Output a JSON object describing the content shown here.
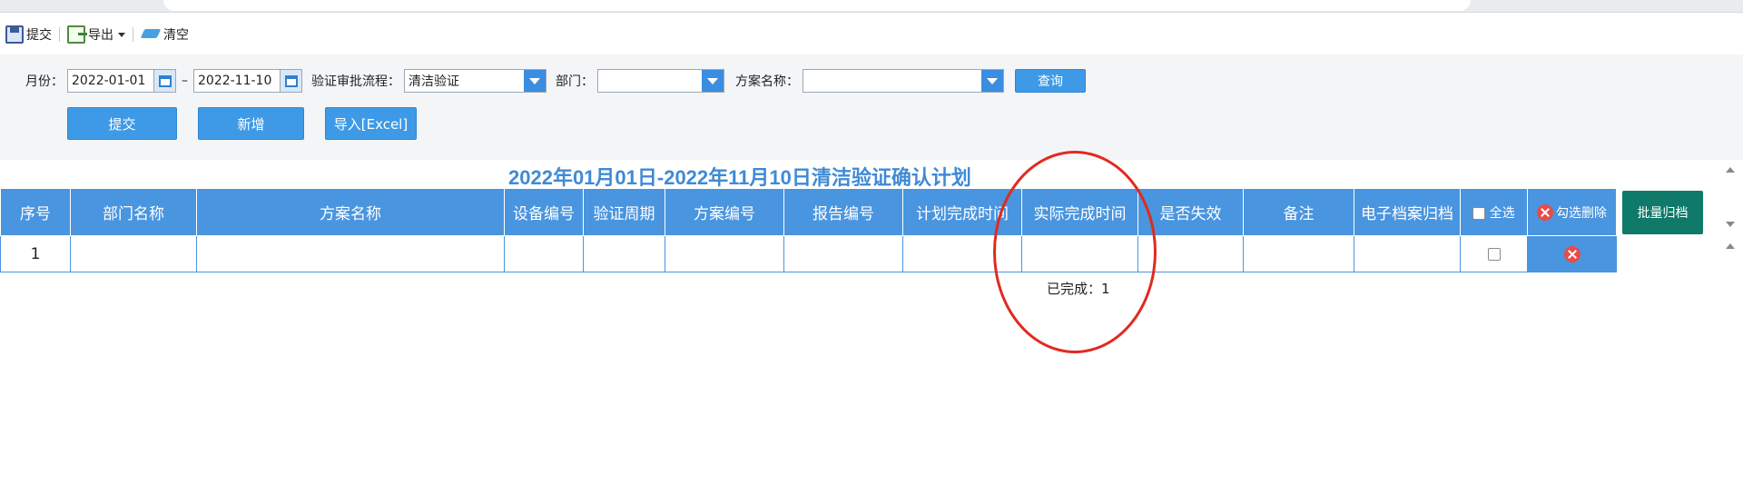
{
  "toolbar": {
    "submit_label": "提交",
    "export_label": "导出",
    "clear_label": "清空"
  },
  "filters": {
    "month_label": "月份：",
    "date_from": "2022-01-01",
    "date_sep": "–",
    "date_to": "2022-11-10",
    "process_label": "验证审批流程：",
    "process_value": "清洁验证",
    "dept_label": "部门：",
    "dept_value": "",
    "plan_label": "方案名称：",
    "plan_value": "",
    "query_label": "查询"
  },
  "actions": {
    "submit_label": "提交",
    "add_label": "新增",
    "import_label": "导入[Excel]"
  },
  "report": {
    "title": "2022年01月01日-2022年11月10日清洁验证确认计划"
  },
  "table": {
    "columns": [
      "序号",
      "部门名称",
      "方案名称",
      "设备编号",
      "验证周期",
      "方案编号",
      "报告编号",
      "计划完成时间",
      "实际完成时间",
      "是否失效",
      "备注",
      "电子档案归档"
    ],
    "select_all_label": "全选",
    "delete_selected_label": "勾选删除",
    "rows": [
      {
        "index": "1",
        "dept": "",
        "plan_name": "",
        "equipment_no": "",
        "cycle": "",
        "plan_no": "",
        "report_no": "",
        "planned_time": "",
        "actual_time": "",
        "invalid": "",
        "remark": "",
        "archive": ""
      }
    ],
    "batch_archive_label": "批量归档"
  },
  "summary": {
    "completed_label": "已完成：1"
  },
  "colors": {
    "header_blue": "#4a95df",
    "button_blue": "#3e9ae6",
    "title_blue": "#3f8ad6",
    "batch_green": "#0f7a6a",
    "annotation_red": "#e02a1f"
  }
}
